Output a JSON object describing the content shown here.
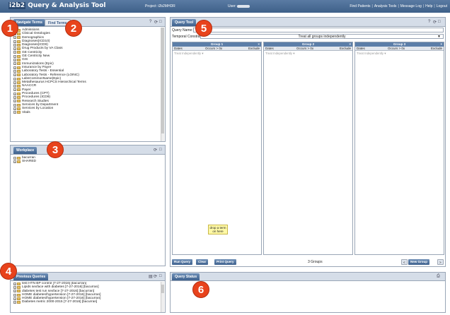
{
  "header": {
    "logo_prefix": "i2b2",
    "title": "Query & Analysis Tool",
    "project_label": "Project: i2b2MHDR",
    "user_label": "User:",
    "menu": [
      "Find Patients",
      "Analysis Tools",
      "Message Log",
      "Help",
      "Logout"
    ],
    "menu_sep": "|"
  },
  "terms_panel": {
    "tab_nav": "Navigate Terms",
    "tab_find": "Find Terms",
    "items": [
      "Admissions",
      "Clinical Ontologies",
      "Demographics",
      "Diagnoses(ICD10)",
      "Diagnoses(ICD9)",
      "Drug Products by VA Class",
      "GE Centricity",
      "GE Centricity New",
      "GIS",
      "Immunizations (Epic)",
      "Insurance by Payer",
      "Laboratory Tests - Essential",
      "Laboratory Tests - Reference (LOINC)",
      "LabsCommonName(Epic)",
      "Metathesaurus HCPCS Hierarchical Terms",
      "NAACCR",
      "Payer",
      "Procedures (CPT)",
      "Procedures (ICD9)",
      "Research Studies",
      "Services by Department",
      "Services by Location",
      "Vitals"
    ]
  },
  "workplace_panel": {
    "title": "Workplace",
    "items": [
      "bacurran",
      "SHARED"
    ]
  },
  "previous_queries": {
    "title": "Previous Queries",
    "items": [
      "test HTN BP control [7-27-2016] [bacurran]",
      "Lipids sexface with diabetes [7-27-2016] [bacurran]",
      "diabetes test run sexface [7-27-2016] [bacurran]",
      "HOME diabetes/hypertension [7-27-2016] [bacurran]",
      "HOME diabetes/hypertension [7-27-2016] [bacurran]",
      "Diabetes metric 2000-2015 [7-27-2016] [bacurran]"
    ]
  },
  "query_tool": {
    "title": "Query Tool",
    "query_name_label": "Query Name:",
    "temporal_label": "Temporal Constraint:",
    "temporal_value": "Treat all groups independently",
    "groups": [
      "Group 1",
      "Group 2",
      "Group 3"
    ],
    "col_dates": "Dates",
    "col_occurs": "Occurs > 0x",
    "col_exclude": "Exclude",
    "treat_label": "Treat Independently",
    "drop_hint": "drop a term on here",
    "buttons": {
      "run": "Run Query",
      "clear": "Clear",
      "print": "Print Query",
      "new_group": "New Group"
    },
    "groups_count": "3 Groups"
  },
  "query_status": {
    "title": "Query Status"
  },
  "annotations": [
    "1",
    "2",
    "3",
    "4",
    "5",
    "6"
  ],
  "colors": {
    "header": "#3e6089",
    "tab": "#4f719c",
    "badge": "#e8431c",
    "drop_zone": "#fff9a6"
  }
}
